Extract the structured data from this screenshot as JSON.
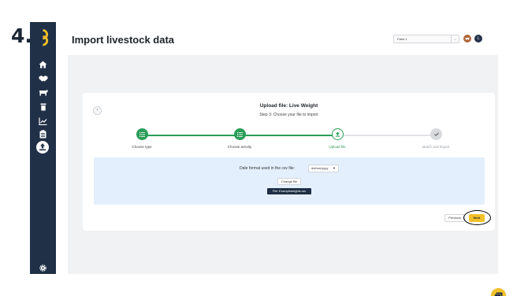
{
  "annotation": {
    "step_number": "4."
  },
  "header": {
    "title": "Import livestock data",
    "farm_select": "Farm 1",
    "farm_avatar": "",
    "user_initial": "L"
  },
  "sidebar": {
    "items": [
      {
        "icon": "home-icon"
      },
      {
        "icon": "handshake-icon"
      },
      {
        "icon": "livestock-icon"
      },
      {
        "icon": "bin-icon"
      },
      {
        "icon": "chart-icon"
      },
      {
        "icon": "clipboard-icon"
      },
      {
        "icon": "upload-icon",
        "active": true
      }
    ],
    "footer_icon": "gear-icon"
  },
  "upload": {
    "title": "Upload file: Live Weight",
    "subtitle": "Step 3: Choose your file to import",
    "steps": [
      {
        "label": "Choose type",
        "state": "done"
      },
      {
        "label": "Choose activity",
        "state": "done"
      },
      {
        "label": "Upload file",
        "state": "current"
      },
      {
        "label": "Match and import",
        "state": "pending"
      }
    ],
    "date_format_label": "Date format used in the csv file:",
    "date_format_value": "dd/mm/yyyy",
    "change_file_label": "Change file",
    "file_tag": "File: Exampleweights.csv"
  },
  "footer": {
    "previous_label": "Previous",
    "next_label": "Next"
  },
  "colors": {
    "sidebar": "#203047",
    "done": "#2a9d58",
    "pending": "#d7d9dc",
    "accent": "#f2c029",
    "upload_bg": "#e4effd"
  }
}
